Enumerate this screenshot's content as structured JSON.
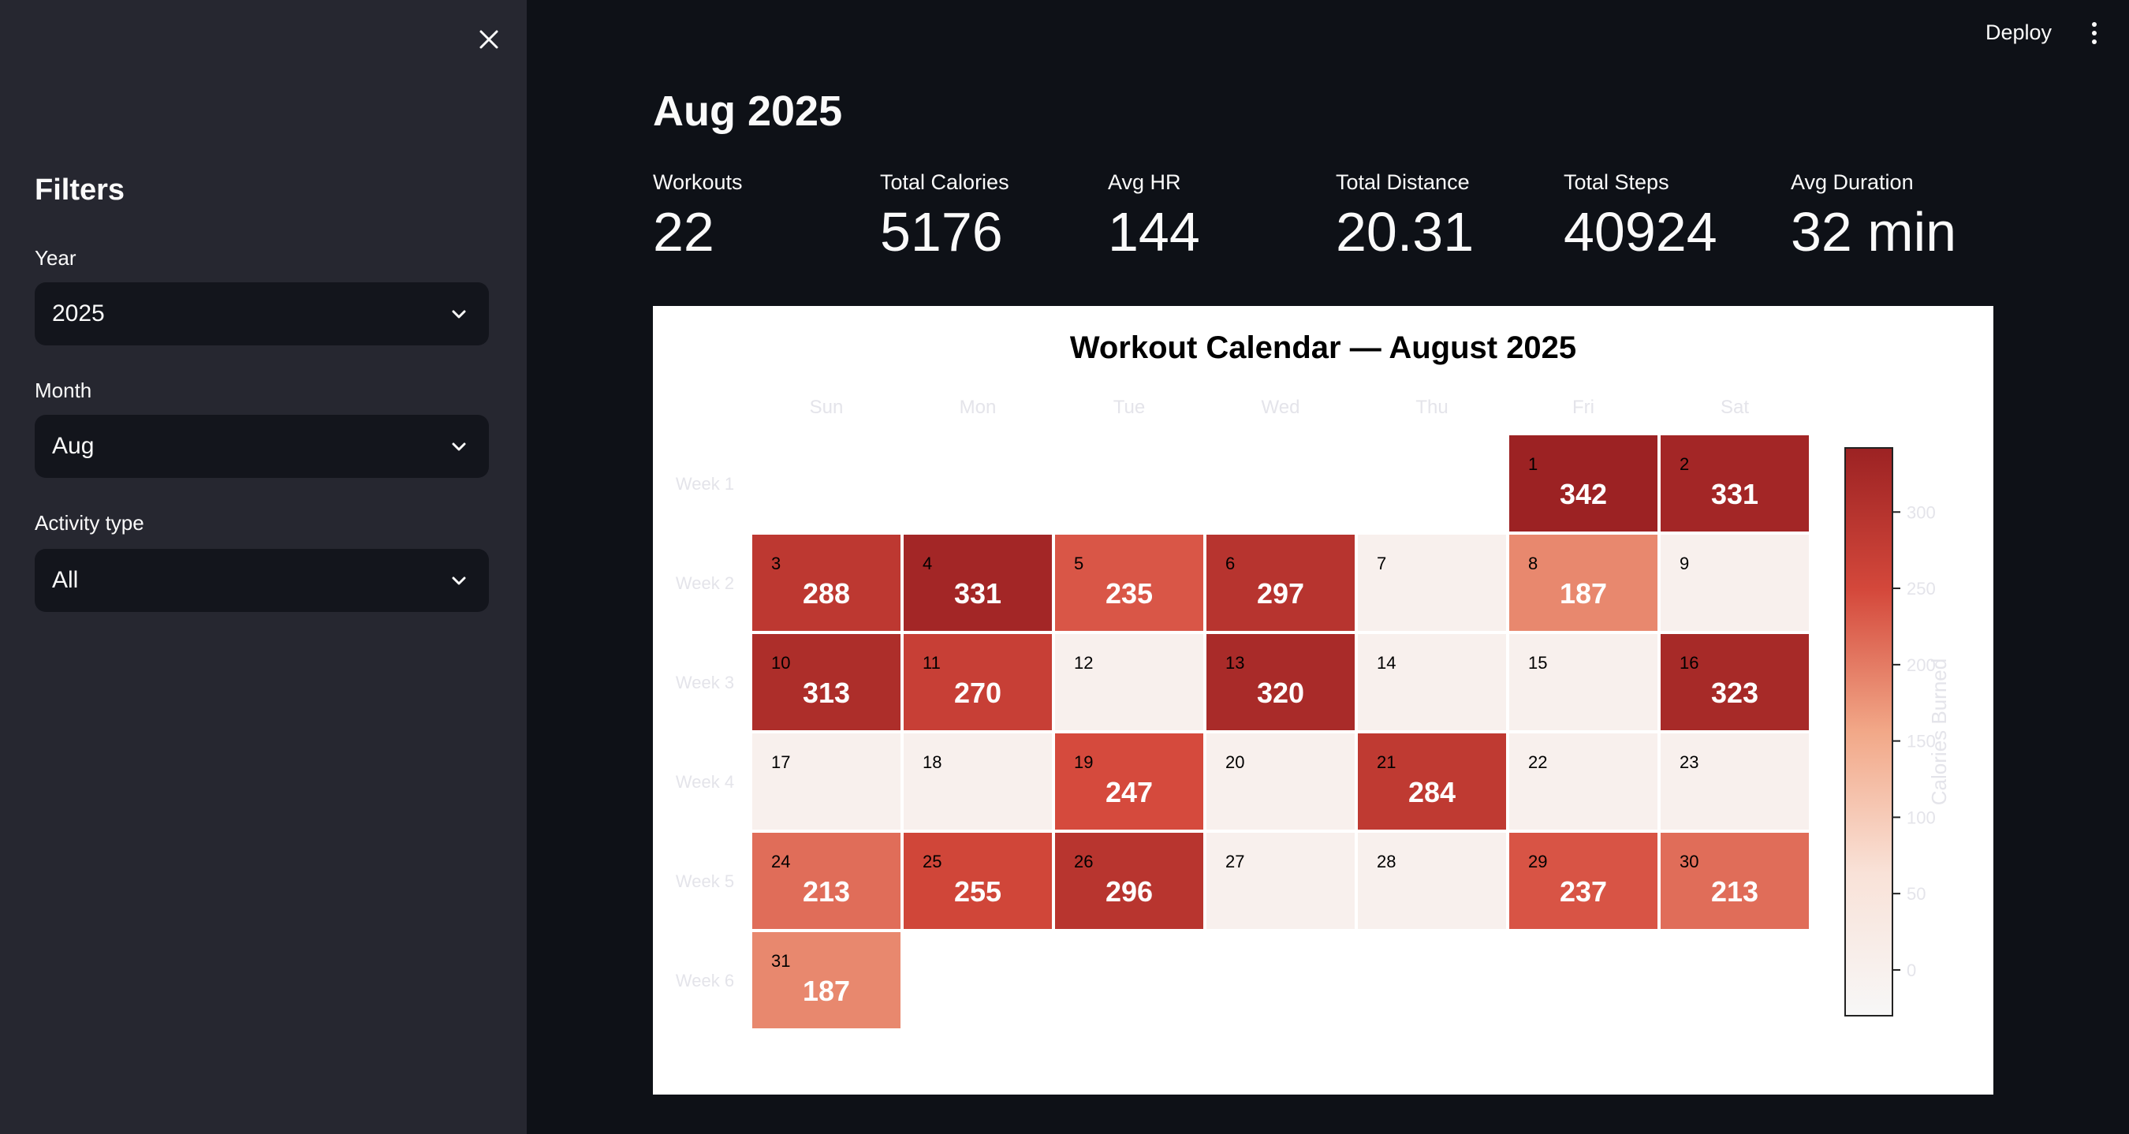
{
  "sidebar": {
    "title": "Filters",
    "filters": [
      {
        "label": "Year",
        "value": "2025"
      },
      {
        "label": "Month",
        "value": "Aug"
      },
      {
        "label": "Activity type",
        "value": "All"
      }
    ]
  },
  "header": {
    "deploy_label": "Deploy"
  },
  "main": {
    "title": "Aug 2025",
    "metrics": [
      {
        "label": "Workouts",
        "value": "22"
      },
      {
        "label": "Total Calories",
        "value": "5176"
      },
      {
        "label": "Avg HR",
        "value": "144"
      },
      {
        "label": "Total Distance",
        "value": "20.31"
      },
      {
        "label": "Total Steps",
        "value": "40924"
      },
      {
        "label": "Avg Duration",
        "value": "32 min"
      }
    ]
  },
  "colors": {
    "app_bg": "#0e1117",
    "sidebar_bg": "#262730",
    "select_bg": "#13151c",
    "colormap_low": "#f7f7f7",
    "colormap_high": "#9c2223"
  },
  "chart_data": {
    "type": "heatmap",
    "title": "Workout Calendar — August 2025",
    "columns": [
      "Sun",
      "Mon",
      "Tue",
      "Wed",
      "Thu",
      "Fri",
      "Sat"
    ],
    "rows": [
      "Week 1",
      "Week 2",
      "Week 3",
      "Week 4",
      "Week 5",
      "Week 6"
    ],
    "first_weekday_index": 5,
    "days_in_month": 31,
    "calories_by_day": {
      "1": 342,
      "2": 331,
      "3": 288,
      "4": 331,
      "5": 235,
      "6": 297,
      "7": 0,
      "8": 187,
      "9": 0,
      "10": 313,
      "11": 270,
      "12": 0,
      "13": 320,
      "14": 0,
      "15": 0,
      "16": 323,
      "17": 0,
      "18": 0,
      "19": 247,
      "20": 0,
      "21": 284,
      "22": 0,
      "23": 0,
      "24": 213,
      "25": 255,
      "26": 296,
      "27": 0,
      "28": 0,
      "29": 237,
      "30": 213,
      "31": 187
    },
    "colorbar": {
      "label": "Calories Burned",
      "ticks": [
        0,
        50,
        100,
        150,
        200,
        250,
        300
      ],
      "range": [
        -30,
        342
      ]
    }
  }
}
